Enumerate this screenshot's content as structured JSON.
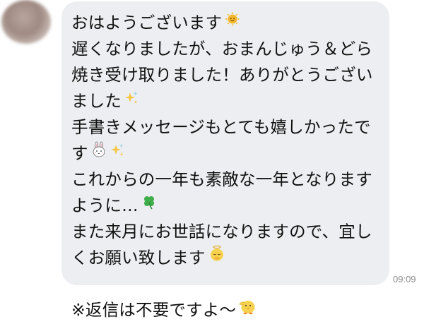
{
  "chat": {
    "message": {
      "lines": [
        "おはようございます",
        "遅くなりましたが、おまんじゅう＆どら",
        "焼き受け取りました！ありがとうござい",
        "ました",
        "手書きメッセージもとても嬉しかったで",
        "す",
        "これからの一年も素敵な一年となります",
        "ように…",
        "また来月にお世話になりますので、宜し",
        "くお願い致します",
        "",
        "※返信は不要ですよ〜"
      ]
    },
    "timestamp": "09:09"
  },
  "icons": [
    "sun-face-icon",
    "sparkles-icon",
    "bunny-face-icon",
    "sparkles-icon",
    "four-leaf-clover-icon",
    "bowing-angel-icon",
    "chick-saluting-icon"
  ],
  "colors": {
    "bubble": "#eceef1",
    "text": "#111111",
    "timestamp": "#8a8a8a"
  }
}
